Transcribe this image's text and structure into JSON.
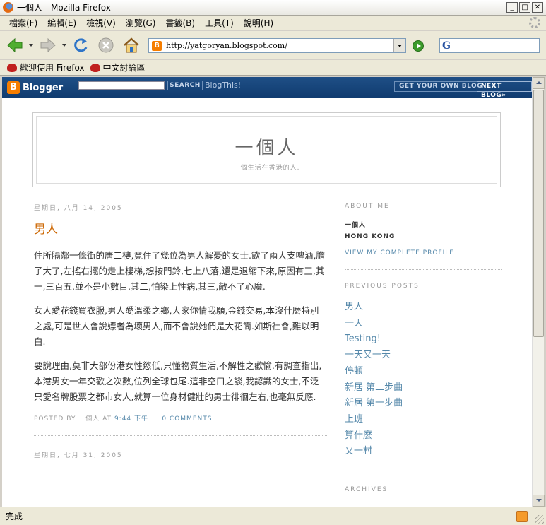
{
  "window": {
    "title": "一個人 - Mozilla Firefox",
    "min": "_",
    "max": "□",
    "close": "✕"
  },
  "menu": [
    "檔案(F)",
    "編輯(E)",
    "檢視(V)",
    "瀏覽(G)",
    "書籤(B)",
    "工具(T)",
    "說明(H)"
  ],
  "nav": {
    "url": "http://yatgoryan.blogspot.com/",
    "search_engine_icon": "G"
  },
  "bookmarks": [
    "歡迎使用 Firefox",
    "中文討論區"
  ],
  "blogger_bar": {
    "logo": "Blogger",
    "search_label": "SEARCH",
    "blogthis": "BlogThis!",
    "get_blog": "GET YOUR OWN BLOG",
    "next_blog": "NEXT BLOG»"
  },
  "blog": {
    "title": "一個人",
    "description": "一個生活在香港的人."
  },
  "posts": [
    {
      "date": "星期日, 八月 14, 2005",
      "title": "男人",
      "paragraphs": [
        "住所隔鄰一條街的唐二樓,竟住了幾位為男人解憂的女士.飲了兩大支啤酒,膽子大了,左搖右擺的走上樓梯,想按門鈴,七上八落,還是退縮下來,原因有三,其一,三百五,並不是小數目,其二,怕染上性病,其三,敵不了心魔.",
        "女人愛花錢買衣服,男人愛溫柔之鄉,大家你情我願,金錢交易,本沒什麼特別之處,可是世人會說嫖者為壞男人,而不會說她們是大花筒.如斯社會,難以明白.",
        "要說理由,莫非大部份港女性慾低,只懂物質生活,不解性之歡愉.有調查指出,本港男女一年交歡之次數,位列全球包尾.這非空口之談,我認識的女士,不泛只愛名牌股票之都市女人,就算一位身材健壯的男士徘徊左右,也毫無反應."
      ],
      "posted_by": "POSTED BY 一個人 AT",
      "time": "9:44 下午",
      "comments": "0 COMMENTS"
    }
  ],
  "next_post": {
    "date": "星期日, 七月 31, 2005"
  },
  "sidebar": {
    "about_heading": "ABOUT ME",
    "name": "一個人",
    "location": "HONG KONG",
    "profile_link": "VIEW MY COMPLETE PROFILE",
    "previous_heading": "PREVIOUS POSTS",
    "previous_posts": [
      "男人",
      "一天",
      "Testing!",
      "一天又一天",
      "停頓",
      "新居 第二步曲",
      "新居 第一步曲",
      "上班",
      "算什麼",
      "又一村"
    ],
    "archives_heading": "ARCHIVES"
  },
  "status": {
    "text": "完成"
  },
  "colors": {
    "accent": "#cc6600",
    "link": "#5588aa",
    "blogger_bar": "#1f4f86"
  }
}
